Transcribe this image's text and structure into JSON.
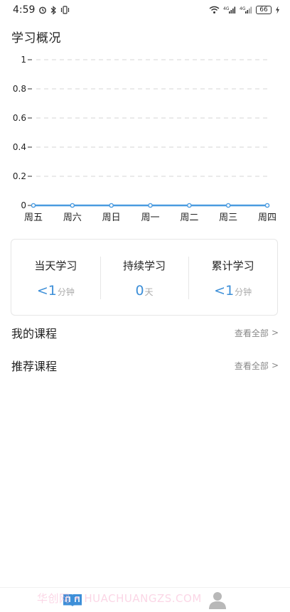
{
  "status_bar": {
    "time": "4:59",
    "battery": "66",
    "left_icons": [
      "alarm-icon",
      "bluetooth-icon",
      "vibrate-icon"
    ],
    "right_icons": [
      "wifi-icon",
      "signal-4g-icon",
      "signal-4g-icon",
      "battery-icon",
      "charging-icon"
    ]
  },
  "page_title": "学习概况",
  "chart_data": {
    "type": "line",
    "categories": [
      "周五",
      "周六",
      "周日",
      "周一",
      "周二",
      "周三",
      "周四"
    ],
    "values": [
      0,
      0,
      0,
      0,
      0,
      0,
      0
    ],
    "y_ticks": [
      "0",
      "0.2",
      "0.4",
      "0.6",
      "0.8",
      "1"
    ],
    "ylim": [
      0,
      1
    ],
    "grid": true,
    "color": "#4a9be0",
    "title": "",
    "xlabel": "",
    "ylabel": ""
  },
  "stats": [
    {
      "label": "当天学习",
      "value": "<1",
      "unit": "分钟"
    },
    {
      "label": "持续学习",
      "value": "0",
      "unit": "天"
    },
    {
      "label": "累计学习",
      "value": "<1",
      "unit": "分钟"
    }
  ],
  "sections": {
    "my_courses": {
      "title": "我的课程",
      "see_all": "查看全部",
      "chevron": ">"
    },
    "recommended": {
      "title": "推荐课程",
      "see_all": "查看全部",
      "chevron": ">"
    }
  },
  "watermark": "华创网 • HUACHUANGZS.COM",
  "bottom_nav": [
    {
      "name": "study-tab",
      "icon": "book-icon",
      "active": true,
      "color": "#3d8fd8"
    },
    {
      "name": "profile-tab",
      "icon": "person-icon",
      "active": false,
      "color": "#b8b8b8"
    }
  ],
  "colors": {
    "accent": "#3d8fd8",
    "muted": "#aaaaaa",
    "grid": "#e3e3e3"
  }
}
